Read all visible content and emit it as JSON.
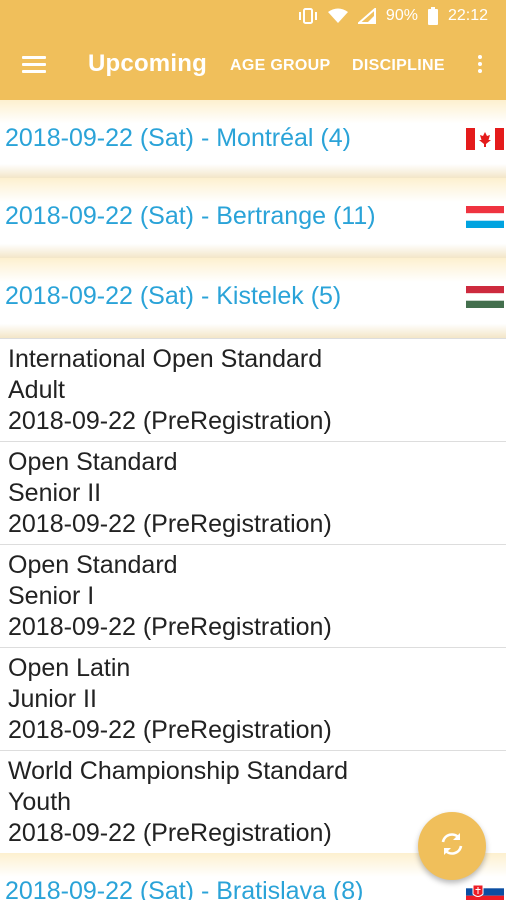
{
  "status_bar": {
    "battery": "90%",
    "time": "22:12"
  },
  "app_bar": {
    "title": "Upcoming",
    "age_group": "AGE GROUP",
    "discipline": "DISCIPLINE"
  },
  "groups": [
    {
      "label": "2018-09-22 (Sat) - Montréal (4)",
      "flag": "canada-flag"
    },
    {
      "label": "2018-09-22 (Sat) - Bertrange (11)",
      "flag": "luxembourg-flag"
    },
    {
      "label": "2018-09-22 (Sat) - Kistelek (5)",
      "flag": "hungary-flag"
    },
    {
      "label": "2018-09-22 (Sat) - Bratislava (8)",
      "flag": "slovakia-flag"
    }
  ],
  "events": [
    {
      "title": "International Open Standard",
      "age": "Adult",
      "date": "2018-09-22 (PreRegistration)"
    },
    {
      "title": "Open Standard",
      "age": "Senior II",
      "date": "2018-09-22 (PreRegistration)"
    },
    {
      "title": "Open Standard",
      "age": "Senior I",
      "date": "2018-09-22 (PreRegistration)"
    },
    {
      "title": "Open Latin",
      "age": "Junior II",
      "date": "2018-09-22 (PreRegistration)"
    },
    {
      "title": "World Championship Standard",
      "age": "Youth",
      "date": "2018-09-22 (PreRegistration)"
    }
  ],
  "colors": {
    "accent": "#f0bf5b",
    "link": "#2aa3d8",
    "text": "#222222"
  }
}
